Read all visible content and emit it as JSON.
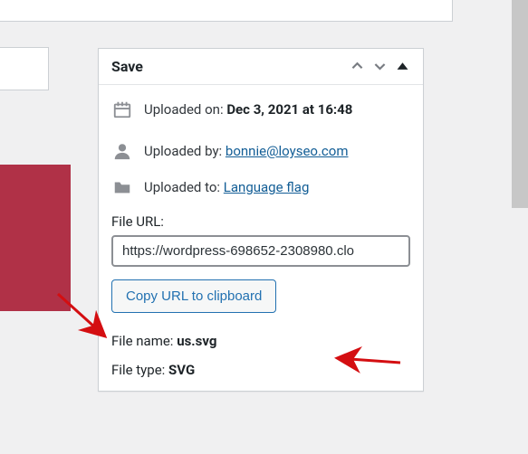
{
  "panel": {
    "title": "Save",
    "upload_date_label": "Uploaded on:",
    "upload_date_value": "Dec 3, 2021 at 16:48",
    "upload_by_label": "Uploaded by:",
    "upload_by_link": "bonnie@loyseo.com",
    "upload_to_label": "Uploaded to:",
    "upload_to_link": "Language flag",
    "file_url_label": "File URL:",
    "file_url_value": "https://wordpress-698652-2308980.clo",
    "copy_button_label": "Copy URL to clipboard",
    "file_name_label": "File name:",
    "file_name_value": "us.svg",
    "file_type_label": "File type:",
    "file_type_value": "SVG"
  }
}
